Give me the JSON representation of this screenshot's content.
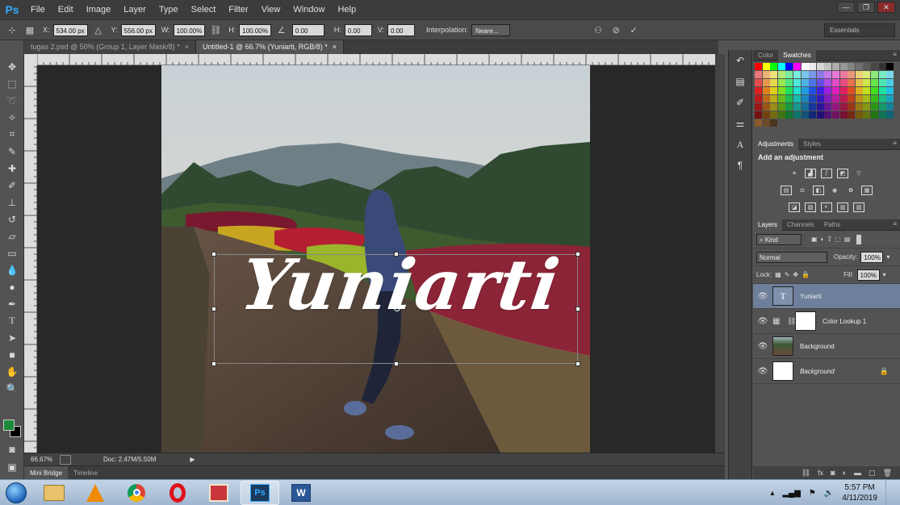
{
  "app": {
    "logo": "Ps",
    "menu": [
      "File",
      "Edit",
      "Image",
      "Layer",
      "Type",
      "Select",
      "Filter",
      "View",
      "Window",
      "Help"
    ],
    "window_controls": [
      "—",
      "❐",
      "✕"
    ]
  },
  "options": {
    "x_label": "X:",
    "x_value": "534.00 px",
    "y_label": "Y:",
    "y_value": "556.00 px",
    "w_label": "W:",
    "w_value": "100.00%",
    "h_label": "H:",
    "h_value": "100.00%",
    "angle_value": "0.00",
    "hskew_label": "H:",
    "hskew_value": "0.00",
    "vskew_label": "V:",
    "vskew_value": "0.00",
    "interp_label": "Interpolation:",
    "interp_value": "Neare...",
    "workspace": "Essentials"
  },
  "tabs": [
    {
      "label": "tugas 2.psd @ 50% (Group 1, Layer Mask/8) *",
      "close": "×",
      "active": false
    },
    {
      "label": "Untitled-1 @ 66.7% (Yuniarti, RGB/8) *",
      "close": "×",
      "active": true
    }
  ],
  "canvas": {
    "text": "Yuniarti"
  },
  "status": {
    "zoom": "66.67%",
    "doc": "Doc: 2.47M/5.50M"
  },
  "bottom_tabs": [
    "Mini Bridge",
    "Timeline"
  ],
  "color_panel": {
    "tabs": [
      "Color",
      "Swatches"
    ]
  },
  "adjustments": {
    "tabs": [
      "Adjustments",
      "Styles"
    ],
    "title": "Add an adjustment"
  },
  "layers_panel": {
    "tabs": [
      "Layers",
      "Channels",
      "Paths"
    ],
    "kind": "Kind",
    "blend_mode": "Normal",
    "opacity_label": "Opacity:",
    "opacity_value": "100%",
    "lock_label": "Lock:",
    "fill_label": "Fill:",
    "fill_value": "100%",
    "layers": [
      {
        "name": "Yuniarti",
        "type": "text",
        "selected": true
      },
      {
        "name": "Color Lookup 1",
        "type": "adjustment",
        "selected": false
      },
      {
        "name": "Background",
        "type": "photo",
        "selected": false
      },
      {
        "name": "Background",
        "type": "white",
        "selected": false,
        "locked": true
      }
    ]
  },
  "taskbar": {
    "time": "5:57 PM",
    "date": "4/11/2019",
    "apps": [
      "explorer",
      "vlc",
      "chrome",
      "opera",
      "paint",
      "photoshop",
      "word"
    ]
  },
  "colors": {
    "accent_blue": "#31a8ff",
    "selected_layer": "#6d7f9a",
    "foreground_swatch": "#1d8b3a"
  }
}
